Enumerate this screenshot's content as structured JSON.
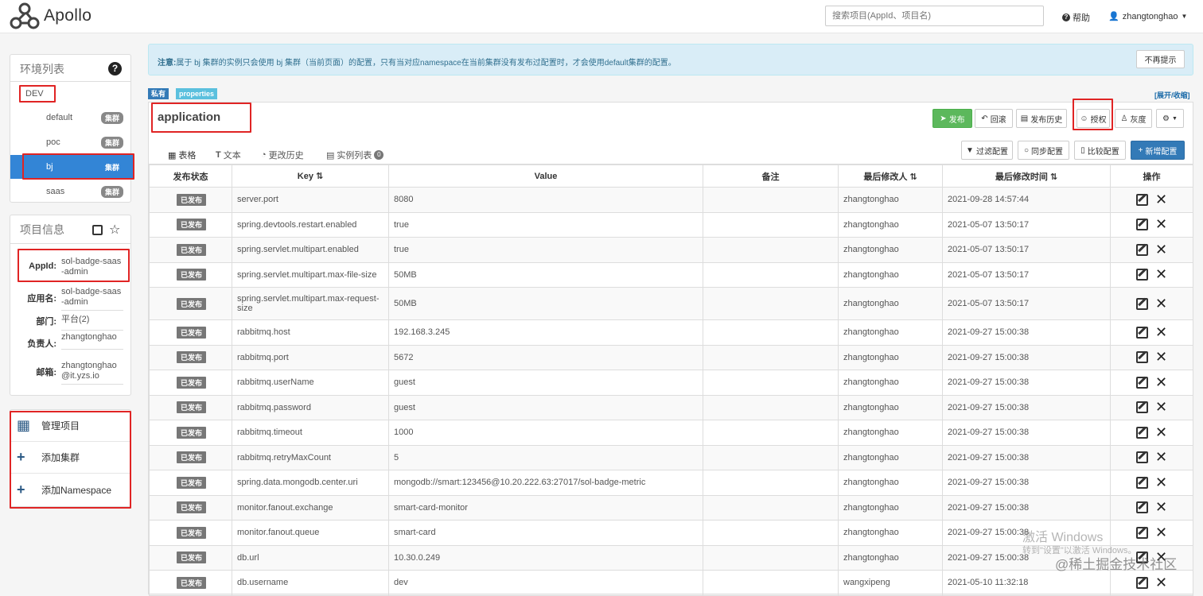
{
  "app": {
    "name": "Apollo"
  },
  "header": {
    "search_placeholder": "搜索项目(AppId、项目名)",
    "help": "帮助",
    "user": "zhangtonghao"
  },
  "env": {
    "title": "环境列表",
    "name": "DEV",
    "clusters": [
      {
        "label": "default",
        "badge": "集群"
      },
      {
        "label": "poc",
        "badge": "集群"
      },
      {
        "label": "bj",
        "badge": "集群"
      },
      {
        "label": "saas",
        "badge": "集群"
      }
    ]
  },
  "project": {
    "title": "项目信息",
    "appid_label": "AppId:",
    "appid": "sol-badge-saas-admin",
    "name_label": "应用名:",
    "name": "sol-badge-saas-admin",
    "dept_label": "部门:",
    "dept": "平台(2)",
    "owner_label": "负责人:",
    "owner": "zhangtonghao",
    "email_label": "邮箱:",
    "email": "zhangtonghao@it.yzs.io"
  },
  "actions": {
    "manage": "管理项目",
    "add_cluster": "添加集群",
    "add_namespace": "添加Namespace"
  },
  "notice": {
    "prefix": "注意:",
    "text": "属于 bj 集群的实例只会使用 bj 集群（当前页面）的配置，只有当对应namespace在当前集群没有发布过配置时，才会使用default集群的配置。",
    "button": "不再提示"
  },
  "namespace": {
    "tag_private": "私有",
    "tag_format": "properties",
    "expand": "[展开/收缩]",
    "title": "application",
    "btn_publish": "发布",
    "btn_rollback": "回滚",
    "btn_history": "发布历史",
    "btn_auth": "授权",
    "btn_gray": "灰度",
    "btn_filter": "过滤配置",
    "btn_sync": "同步配置",
    "btn_compare": "比较配置",
    "btn_add": "新增配置",
    "tabs": {
      "table": "表格",
      "text": "文本",
      "history": "更改历史",
      "instances": "实例列表",
      "instances_count": "0"
    }
  },
  "table": {
    "headers": [
      "发布状态",
      "Key",
      "Value",
      "备注",
      "最后修改人",
      "最后修改时间",
      "操作"
    ],
    "sort_icon": "⇅",
    "status": "已发布",
    "rows": [
      {
        "key": "server.port",
        "value": "8080",
        "remark": "",
        "user": "zhangtonghao",
        "time": "2021-09-28 14:57:44"
      },
      {
        "key": "spring.devtools.restart.enabled",
        "value": "true",
        "remark": "",
        "user": "zhangtonghao",
        "time": "2021-05-07 13:50:17"
      },
      {
        "key": "spring.servlet.multipart.enabled",
        "value": "true",
        "remark": "",
        "user": "zhangtonghao",
        "time": "2021-05-07 13:50:17"
      },
      {
        "key": "spring.servlet.multipart.max-file-size",
        "value": "50MB",
        "remark": "",
        "user": "zhangtonghao",
        "time": "2021-05-07 13:50:17"
      },
      {
        "key": "spring.servlet.multipart.max-request-size",
        "value": "50MB",
        "remark": "",
        "user": "zhangtonghao",
        "time": "2021-05-07 13:50:17"
      },
      {
        "key": "rabbitmq.host",
        "value": "192.168.3.245",
        "remark": "",
        "user": "zhangtonghao",
        "time": "2021-09-27 15:00:38"
      },
      {
        "key": "rabbitmq.port",
        "value": "5672",
        "remark": "",
        "user": "zhangtonghao",
        "time": "2021-09-27 15:00:38"
      },
      {
        "key": "rabbitmq.userName",
        "value": "guest",
        "remark": "",
        "user": "zhangtonghao",
        "time": "2021-09-27 15:00:38"
      },
      {
        "key": "rabbitmq.password",
        "value": "guest",
        "remark": "",
        "user": "zhangtonghao",
        "time": "2021-09-27 15:00:38"
      },
      {
        "key": "rabbitmq.timeout",
        "value": "1000",
        "remark": "",
        "user": "zhangtonghao",
        "time": "2021-09-27 15:00:38"
      },
      {
        "key": "rabbitmq.retryMaxCount",
        "value": "5",
        "remark": "",
        "user": "zhangtonghao",
        "time": "2021-09-27 15:00:38"
      },
      {
        "key": "spring.data.mongodb.center.uri",
        "value": "mongodb://smart:123456@10.20.222.63:27017/sol-badge-metric",
        "remark": "",
        "user": "zhangtonghao",
        "time": "2021-09-27 15:00:38"
      },
      {
        "key": "monitor.fanout.exchange",
        "value": "smart-card-monitor",
        "remark": "",
        "user": "zhangtonghao",
        "time": "2021-09-27 15:00:38"
      },
      {
        "key": "monitor.fanout.queue",
        "value": "smart-card",
        "remark": "",
        "user": "zhangtonghao",
        "time": "2021-09-27 15:00:38"
      },
      {
        "key": "db.url",
        "value": "10.30.0.249",
        "remark": "",
        "user": "zhangtonghao",
        "time": "2021-09-27 15:00:38"
      },
      {
        "key": "db.username",
        "value": "dev",
        "remark": "",
        "user": "wangxipeng",
        "time": "2021-05-10 11:32:18"
      }
    ]
  },
  "watermark": {
    "line1": "激活 Windows",
    "line2": "转到\"设置\"以激活 Windows。",
    "line3": "@稀土掘金技术社区"
  }
}
